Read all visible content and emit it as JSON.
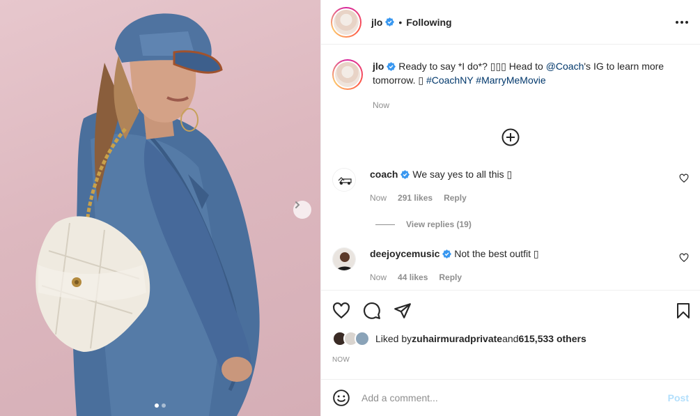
{
  "header": {
    "username": "jlo",
    "dot": "•",
    "following_label": "Following"
  },
  "caption": {
    "username": "jlo",
    "text_1": "Ready to say *I do*? ▯▯▯ Head to ",
    "mention": "@Coach",
    "text_2": "'s IG to learn more tomorrow. ▯ ",
    "hashtag_1": "#CoachNY",
    "hashtag_2": "#MarryMeMovie",
    "time": "Now"
  },
  "comments": [
    {
      "username": "coach",
      "text": "We say yes to all this ▯",
      "time": "Now",
      "likes": "291 likes",
      "reply_label": "Reply",
      "view_replies": "View replies (19)"
    },
    {
      "username": "deejoycemusic",
      "text": "Not the best outfit ▯",
      "time": "Now",
      "likes": "44 likes",
      "reply_label": "Reply"
    }
  ],
  "likes": {
    "prefix": "Liked by ",
    "user": "zuhairmuradprivate",
    "and": " and ",
    "others": "615,533 others"
  },
  "post_time": "NOW",
  "add_comment": {
    "placeholder": "Add a comment...",
    "post_label": "Post"
  },
  "media": {
    "current_slide": 1,
    "total_slides": 2
  },
  "colors": {
    "verified": "#3897f0",
    "link": "#00376b",
    "post_disabled": "#b2dffc",
    "background": "#dcb9c0"
  },
  "icons": [
    "verified-badge-icon",
    "more-options-icon",
    "add-circle-icon",
    "heart-icon",
    "comment-icon",
    "share-icon",
    "bookmark-icon",
    "emoji-icon",
    "chevron-right-icon"
  ]
}
